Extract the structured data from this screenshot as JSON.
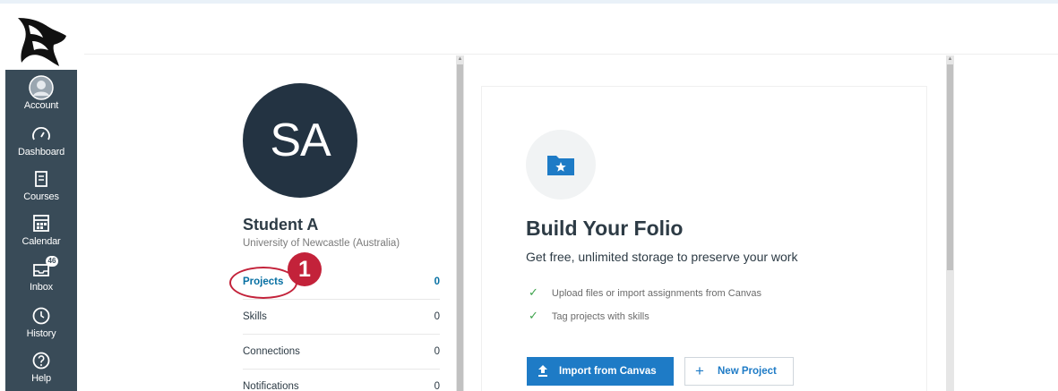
{
  "nav": {
    "items": [
      {
        "label": "Account",
        "icon": "account-icon"
      },
      {
        "label": "Dashboard",
        "icon": "dashboard-icon"
      },
      {
        "label": "Courses",
        "icon": "courses-icon"
      },
      {
        "label": "Calendar",
        "icon": "calendar-icon"
      },
      {
        "label": "Inbox",
        "icon": "inbox-icon",
        "badge": "46"
      },
      {
        "label": "History",
        "icon": "history-icon"
      },
      {
        "label": "Help",
        "icon": "help-icon"
      }
    ]
  },
  "profile": {
    "initials": "SA",
    "name": "Student A",
    "university": "University of Newcastle (Australia)",
    "menu": [
      {
        "label": "Projects",
        "count": "0",
        "active": true
      },
      {
        "label": "Skills",
        "count": "0"
      },
      {
        "label": "Connections",
        "count": "0"
      },
      {
        "label": "Notifications",
        "count": "0"
      }
    ]
  },
  "callout": {
    "number": "1",
    "color": "#c3223a"
  },
  "folio": {
    "title": "Build Your Folio",
    "subtitle": "Get free, unlimited storage to preserve your work",
    "features": [
      "Upload files or import assignments from Canvas",
      "Tag projects with skills"
    ],
    "import_label": "Import from Canvas",
    "new_label": "New Project"
  },
  "colors": {
    "nav_bg": "#394b58",
    "avatar_bg": "#233342",
    "primary": "#1e7bc6",
    "link": "#0770a3",
    "check": "#3fa34d"
  }
}
